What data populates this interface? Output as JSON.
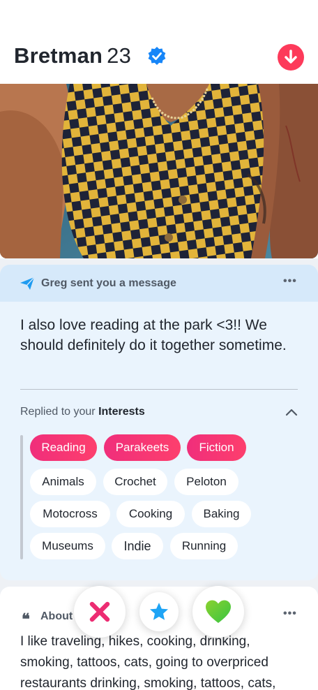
{
  "profile": {
    "name": "Bretman",
    "age": "23"
  },
  "message": {
    "header": "Greg sent you a message",
    "menu": "•••",
    "body": "I also love reading at the park <3!! We should definitely do it together sometime.",
    "replied_prefix": "Replied to your ",
    "replied_target": "Interests"
  },
  "interests": {
    "highlighted": [
      "Reading",
      "Parakeets",
      "Fiction"
    ],
    "others": [
      "Animals",
      "Crochet",
      "Peloton",
      "Motocross",
      "Cooking",
      "Baking",
      "Museums",
      "Indie",
      "Running"
    ]
  },
  "about": {
    "title": "About",
    "menu": "•••",
    "text": "I like traveling, hikes, cooking, drinking, smoking, tattoos, cats, going to overpriced restaurants drinking, smoking, tattoos, cats,"
  },
  "actions": {
    "nope": "nope",
    "super_like": "super like",
    "like": "like"
  },
  "colors": {
    "brand_red": "#fd3a5a",
    "interest_pink": "#f02e7b",
    "verified_blue": "#1786f8",
    "like_green": "#5ad135",
    "nope_pink": "#ec2c72",
    "star_blue": "#1ea4f5"
  },
  "icons": {
    "verified": "verified-badge-icon",
    "collapse": "arrow-down-icon",
    "message": "paper-plane-icon",
    "chevron": "chevron-up-icon",
    "about": "quote-icon",
    "nope": "x-icon",
    "super_like": "star-icon",
    "like": "heart-icon"
  }
}
